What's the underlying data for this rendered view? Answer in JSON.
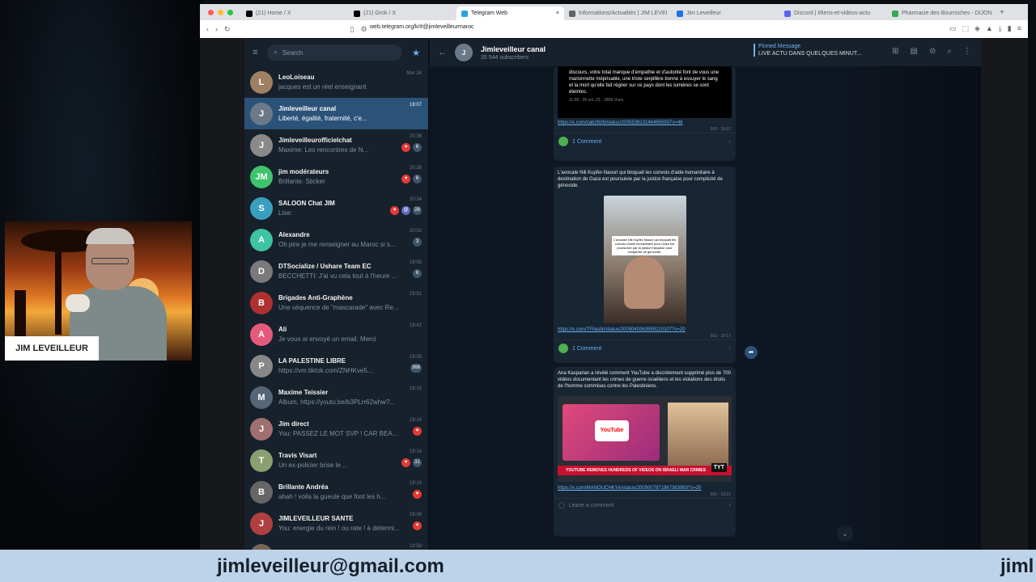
{
  "browser": {
    "tabs": [
      {
        "label": "(21) Home / X",
        "icon": "x-icon",
        "color": "#000000"
      },
      {
        "label": "(21) Grok / X",
        "icon": "x-icon",
        "color": "#000000"
      },
      {
        "label": "Telegram Web",
        "icon": "telegram-icon",
        "color": "#2aa3e0",
        "active": true
      },
      {
        "label": "Informations/Actualités | JIM LEVEI",
        "icon": "page-icon",
        "color": "#5f6368"
      },
      {
        "label": "Jim Leveilleur",
        "icon": "page-icon",
        "color": "#1a73e8"
      },
      {
        "label": "Discord | #liens-et-vidéos-actu",
        "icon": "discord-icon",
        "color": "#5865f2"
      },
      {
        "label": "Pharmacie des Bourroches - DIJON",
        "icon": "page-icon",
        "color": "#34a853"
      }
    ],
    "url": "web.telegram.org/k/#@jimleveilleurmaroc"
  },
  "telegram": {
    "search_placeholder": "Search",
    "chats": [
      {
        "name": "LeoLoiseau",
        "preview": "jacques est un réel enseignant",
        "time": "Mar 24",
        "avatar_color": "#a08060",
        "initial": "L",
        "badges": []
      },
      {
        "name": "Jimleveilleur canal",
        "preview": "Liberté, égalité, fraternité, c'e...",
        "time": "19:07",
        "avatar_color": "#6b7a88",
        "initial": "J",
        "active": true,
        "badges": []
      },
      {
        "name": "Jimleveilleurofficielchat",
        "preview": "Maxime: Les rencontres de N...",
        "time": "20:38",
        "avatar_color": "#8a8a8a",
        "initial": "J",
        "badges": [
          {
            "t": "♥",
            "c": "red"
          },
          {
            "t": "6",
            "c": ""
          }
        ]
      },
      {
        "name": "jim modérateurs",
        "preview": "Brillante: Sticker",
        "time": "20:38",
        "avatar_color": "#3ec46d",
        "initial": "JM",
        "badges": [
          {
            "t": "♥",
            "c": "red"
          },
          {
            "t": "6",
            "c": ""
          }
        ]
      },
      {
        "name": "SALOON Chat JIM",
        "preview": "Lise:",
        "time": "20:34",
        "avatar_color": "#3a9fbf",
        "initial": "S",
        "badges": [
          {
            "t": "♥",
            "c": "red"
          },
          {
            "t": "@",
            "c": "blue"
          },
          {
            "t": "28",
            "c": ""
          }
        ]
      },
      {
        "name": "Alexandre",
        "preview": "Oh pire je me renseigner au Maroc si s...",
        "time": "20:02",
        "avatar_color": "#3ec4a0",
        "initial": "A",
        "badges": [
          {
            "t": "3",
            "c": ""
          }
        ]
      },
      {
        "name": "DTSocialize / Ushare Team EC",
        "preview": "BECCHETTI: J'ai vu cela tout à l'heure e...",
        "time": "19:55",
        "avatar_color": "#7a7a7a",
        "initial": "D",
        "badges": [
          {
            "t": "6",
            "c": ""
          }
        ]
      },
      {
        "name": "Brigades Anti-Graphène",
        "preview": "Une séquence de \"mascarade\" avec Re...",
        "time": "19:51",
        "avatar_color": "#b03030",
        "initial": "B",
        "badges": []
      },
      {
        "name": "Ali",
        "preview": "Je vous ai envoyé un email. Merci",
        "time": "19:42",
        "avatar_color": "#e55a7a",
        "initial": "A",
        "badges": []
      },
      {
        "name": "LA PALESTINE LIBRE",
        "preview": "https://vm.tiktok.com/ZNHKve5...",
        "time": "19:30",
        "avatar_color": "#888888",
        "initial": "P",
        "badges": [
          {
            "t": "368",
            "c": ""
          }
        ]
      },
      {
        "name": "Maxime Teissier",
        "preview": "Album, https://youtu.be/b3PLrr62whw?...",
        "time": "19:15",
        "avatar_color": "#556677",
        "initial": "M",
        "badges": []
      },
      {
        "name": "Jim direct",
        "preview": "You: PASSEZ LE MOT SVP ! CAR BEAU...",
        "time": "19:14",
        "avatar_color": "#a07070",
        "initial": "J",
        "badges": [
          {
            "t": "♥",
            "c": "red"
          }
        ]
      },
      {
        "name": "Travis Visart",
        "preview": "Un ex-policier brise le ...",
        "time": "19:14",
        "avatar_color": "#8aa070",
        "initial": "T",
        "badges": [
          {
            "t": "♥",
            "c": "red"
          },
          {
            "t": "31",
            "c": ""
          }
        ]
      },
      {
        "name": "Brillante Andréa",
        "preview": "ahah ! voila la gueule que font les h...",
        "time": "19:10",
        "avatar_color": "#666666",
        "initial": "B",
        "badges": [
          {
            "t": "♥",
            "c": "red"
          }
        ]
      },
      {
        "name": "JIMLEVEILLEUR SANTE",
        "preview": "You: energie du rein ! ou rate ! à détermi...",
        "time": "19:08",
        "avatar_color": "#b04040",
        "initial": "J",
        "badges": [
          {
            "t": "♥",
            "c": "red"
          }
        ]
      },
      {
        "name": "Juliette",
        "preview": "",
        "time": "18:58",
        "avatar_color": "#776655",
        "initial": "J",
        "badges": []
      }
    ],
    "channel": {
      "title": "Jimleveilleur canal",
      "subscribers": "35 544 subscribers",
      "pinned_label": "Pinned Message",
      "pinned_text": "LIVE ACTU DANS QUELQUES MINUT..."
    },
    "posts": [
      {
        "quote": "discours, votre total manque d'empathie et d'autorité font de vous une marionnette méprisable, une triste serpillère bonne à essuyer le sang et la mort qu'elle fait régner sur ce pays dont les lumières se sont éteintes.",
        "quote_meta": "11:09 · 26 oct. 23 · 186K Vues",
        "link": "https://x.com/cab2626/status/2005538131464655937s=46",
        "meta": "593 · 19:07",
        "comments": "1 Comment"
      },
      {
        "text": "L'avocate Nili Kupfer-Naouri qui bloquait les convois d'aide humanitaire à destination de Gaza est poursuivie par la justice française pour complicité de génocide.",
        "video_caption": "L'avocate Nili Kupfer-Naouri qui bloquait les convois d'aide humanitaire pour Gaza est poursuivie par la justice française pour complicité de génocide.",
        "link": "https://x.com/TFilastin/status/2005040363959210107?s=20",
        "meta": "562 · 19:17",
        "comments": "1 Comment"
      },
      {
        "text": "Ana Kasparian a révélé comment YouTube a discrètement supprimé plus de 700 vidéos documentant les crimes de guerre israéliens et les violations des droits de l'homme commises contre les Palestiniens.",
        "yt_logo": "YouTube",
        "yt_banner": "YOUTUBE REMOVES HUNDREDS OF VIDEOS ON ISRAELI WAR CRIMES",
        "yt_brand": "TYT",
        "link": "https://x.com/MANOUCHKYA/status/2005007871967383993?s=20",
        "meta": "501 · 19:21",
        "comments": "Leave a comment"
      }
    ]
  },
  "overlay": {
    "host_name": "JIM LEVEILLEUR",
    "ticker_email": "jimleveilleur@gmail.com",
    "ticker_partial": "jiml"
  }
}
